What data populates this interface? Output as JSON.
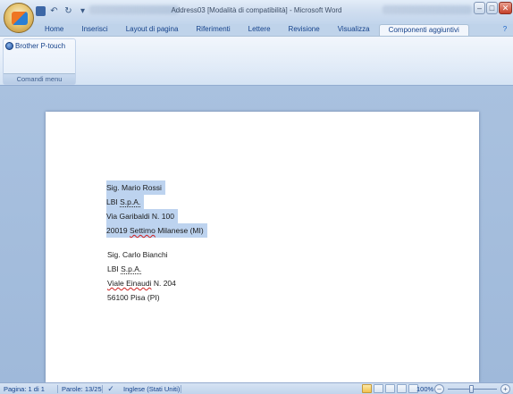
{
  "window": {
    "title": "Address03 [Modalità di compatibilità] - Microsoft Word",
    "controls": {
      "minimize": "–",
      "maximize": "□",
      "close": "✕"
    }
  },
  "quick_access": {
    "undo": "↶",
    "redo": "↻",
    "customize": "▾"
  },
  "tabs": [
    {
      "label": "Home"
    },
    {
      "label": "Inserisci"
    },
    {
      "label": "Layout di pagina"
    },
    {
      "label": "Riferimenti"
    },
    {
      "label": "Lettere"
    },
    {
      "label": "Revisione"
    },
    {
      "label": "Visualizza"
    },
    {
      "label": "Componenti aggiuntivi"
    }
  ],
  "active_tab": "Componenti aggiuntivi",
  "ribbon": {
    "group": {
      "button_label": "Brother P-touch",
      "label": "Comandi menu"
    }
  },
  "document": {
    "addresses": [
      {
        "name": "Sig. Mario Rossi",
        "company_prefix": "LBI ",
        "company_flagged": "S.p.A.",
        "street_prefix": "Via Garibaldi N. 100",
        "city_zip": "20019 ",
        "city_flagged": "Settimo",
        "city_rest": " Milanese (MI)",
        "selected": true
      },
      {
        "name": "Sig. Carlo Bianchi",
        "company_prefix": "LBI ",
        "company_flagged": "S.p.A.",
        "street_flagged": "Viale Einaudi",
        "street_rest": " N. 204",
        "city_line": "56100 Pisa (PI)",
        "selected": false
      }
    ]
  },
  "statusbar": {
    "page": "Pagina: 1 di 1",
    "words": "Parole: 13/25",
    "language": "Inglese (Stati Uniti)",
    "zoom": "100%",
    "zoom_percent": 100
  }
}
